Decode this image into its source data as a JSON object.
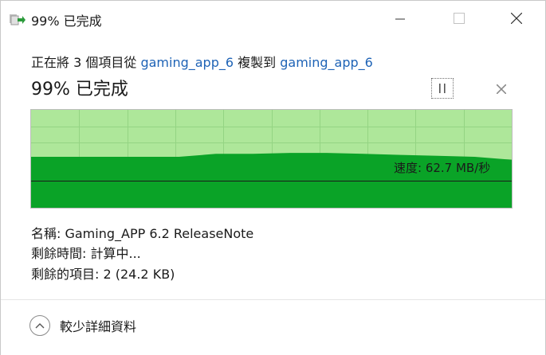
{
  "window": {
    "title": "99% 已完成"
  },
  "copy": {
    "prefix": "正在將 3 個項目從 ",
    "source": "gaming_app_6",
    "middle": " 複製到 ",
    "destination": "gaming_app_6"
  },
  "progress": {
    "title": "99% 已完成",
    "percent": 99
  },
  "graph": {
    "speed_label": "速度: 62.7 MB/秒",
    "speed_mb_per_s": 62.7,
    "fill_color": "#0aa327",
    "background_color": "#aee79a",
    "history_fraction": [
      0.52,
      0.52,
      0.52,
      0.52,
      0.52,
      0.55,
      0.55,
      0.56,
      0.56,
      0.55,
      0.54,
      0.53,
      0.52,
      0.49
    ]
  },
  "details": {
    "name": "名稱: Gaming_APP 6.2 ReleaseNote",
    "time_remaining": "剩餘時間: 計算中...",
    "items_remaining": "剩餘的項目: 2 (24.2 KB)"
  },
  "footer": {
    "less_details_label": "較少詳細資料"
  },
  "icons": {
    "app": "copy-progress-icon",
    "minimize": "minimize-icon",
    "maximize": "maximize-icon",
    "close": "close-icon",
    "pause": "pause-icon",
    "cancel": "cancel-icon",
    "chevron": "chevron-up-icon"
  }
}
